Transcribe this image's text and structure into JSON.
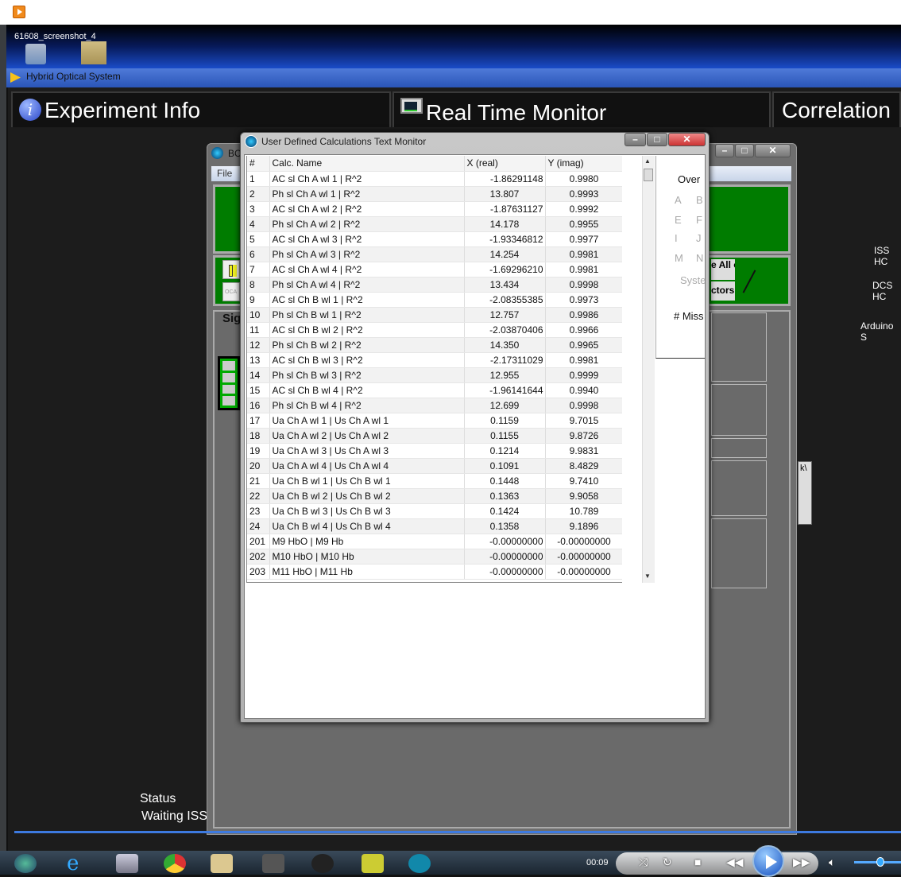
{
  "desktop": {
    "label": "61608_screenshot_4"
  },
  "app": {
    "title": "Hybrid Optical System",
    "tabs": [
      {
        "label": "Experiment Info"
      },
      {
        "label": "Real Time Monitor"
      },
      {
        "label": "Correlation"
      }
    ],
    "side_labels": [
      "ISS HC",
      "DCS HC",
      "Arduino S"
    ],
    "status_label": "Status",
    "status_value": "Waiting ISS"
  },
  "bc_window": {
    "title": "BC",
    "menu_file": "File",
    "pause_label": "OCA",
    "sig_label": "Sig",
    "all_btn": "e All ors",
    "ctr_btn": "ctors",
    "scroll_text": "k\\"
  },
  "monitor": {
    "title": "User Defined Calculations Text Monitor",
    "columns": [
      "#",
      "Calc. Name",
      "X (real)",
      "Y (imag)"
    ],
    "rows": [
      [
        "1",
        "AC sl Ch A wl 1 | R^2",
        "-1.86291148",
        "0.9980"
      ],
      [
        "2",
        "Ph sl Ch A wl 1 | R^2",
        "13.807",
        "0.9993"
      ],
      [
        "3",
        "AC sl Ch A wl 2 | R^2",
        "-1.87631127",
        "0.9992"
      ],
      [
        "4",
        "Ph sl Ch A wl 2 | R^2",
        "14.178",
        "0.9955"
      ],
      [
        "5",
        "AC sl Ch A wl 3 | R^2",
        "-1.93346812",
        "0.9977"
      ],
      [
        "6",
        "Ph sl Ch A wl 3 | R^2",
        "14.254",
        "0.9981"
      ],
      [
        "7",
        "AC sl Ch A wl 4 | R^2",
        "-1.69296210",
        "0.9981"
      ],
      [
        "8",
        "Ph sl Ch A wl 4 | R^2",
        "13.434",
        "0.9998"
      ],
      [
        "9",
        "AC sl Ch B wl 1 | R^2",
        "-2.08355385",
        "0.9973"
      ],
      [
        "10",
        "Ph sl Ch B wl 1 | R^2",
        "12.757",
        "0.9986"
      ],
      [
        "11",
        "AC sl Ch B wl 2 | R^2",
        "-2.03870406",
        "0.9966"
      ],
      [
        "12",
        "Ph sl Ch B wl 2 | R^2",
        "14.350",
        "0.9965"
      ],
      [
        "13",
        "AC sl Ch B wl 3 | R^2",
        "-2.17311029",
        "0.9981"
      ],
      [
        "14",
        "Ph sl Ch B wl 3 | R^2",
        "12.955",
        "0.9999"
      ],
      [
        "15",
        "AC sl Ch B wl 4 | R^2",
        "-1.96141644",
        "0.9940"
      ],
      [
        "16",
        "Ph sl Ch B wl 4 | R^2",
        "12.699",
        "0.9998"
      ],
      [
        "17",
        "Ua Ch A wl 1 | Us Ch A wl 1",
        "0.1159",
        "9.7015"
      ],
      [
        "18",
        "Ua Ch A wl 2 | Us Ch A wl 2",
        "0.1155",
        "9.8726"
      ],
      [
        "19",
        "Ua Ch A wl 3 | Us Ch A wl 3",
        "0.1214",
        "9.9831"
      ],
      [
        "20",
        "Ua Ch A wl 4 | Us Ch A wl 4",
        "0.1091",
        "8.4829"
      ],
      [
        "21",
        "Ua Ch B wl 1 | Us Ch B wl 1",
        "0.1448",
        "9.7410"
      ],
      [
        "22",
        "Ua Ch B wl 2 | Us Ch B wl 2",
        "0.1363",
        "9.9058"
      ],
      [
        "23",
        "Ua Ch B wl 3 | Us Ch B wl 3",
        "0.1424",
        "10.789"
      ],
      [
        "24",
        "Ua Ch B wl 4 | Us Ch B wl 4",
        "0.1358",
        "9.1896"
      ],
      [
        "201",
        "M9 HbO | M9 Hb",
        "-0.00000000",
        "-0.00000000"
      ],
      [
        "202",
        "M10 HbO | M10 Hb",
        "-0.00000000",
        "-0.00000000"
      ],
      [
        "203",
        "M11 HbO | M11 Hb",
        "-0.00000000",
        "-0.00000000"
      ]
    ]
  },
  "side_panel": {
    "over": "Over",
    "r1": [
      "A",
      "B"
    ],
    "r2": [
      "E",
      "F"
    ],
    "r3": [
      "I",
      "J"
    ],
    "r4": [
      "M",
      "N"
    ],
    "syste": "Syste",
    "miss": "# Miss"
  },
  "media": {
    "time": "00:09"
  }
}
